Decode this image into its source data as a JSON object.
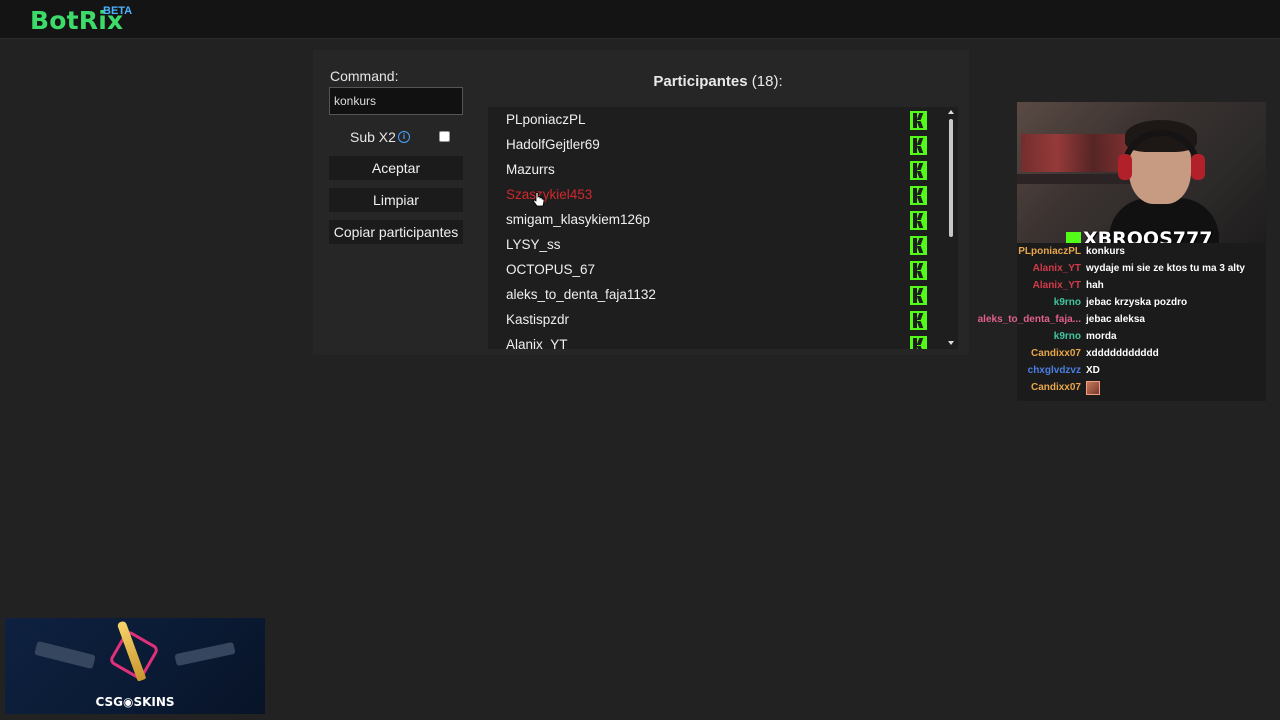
{
  "header": {
    "brand": "BotRix",
    "badge": "BETA"
  },
  "command": {
    "label": "Command:",
    "value": "konkurs"
  },
  "sub_option": {
    "label": "Sub X2",
    "checked": false
  },
  "buttons": {
    "accept": "Aceptar",
    "clear": "Limpiar",
    "copy": "Copiar participantes"
  },
  "participants": {
    "title": "Participantes",
    "count": "(18)",
    "suffix": ":",
    "items": [
      {
        "name": "PLponiaczPL",
        "highlight": false
      },
      {
        "name": "HadolfGejtler69",
        "highlight": false
      },
      {
        "name": "Mazurrs",
        "highlight": false
      },
      {
        "name": "Szaszykiel453",
        "highlight": true
      },
      {
        "name": "smigam_klasykiem126p",
        "highlight": false
      },
      {
        "name": "LYSY_ss",
        "highlight": false
      },
      {
        "name": "OCTOPUS_67",
        "highlight": false
      },
      {
        "name": "aleks_to_denta_faja1132",
        "highlight": false
      },
      {
        "name": "Kastispzdr",
        "highlight": false
      },
      {
        "name": "Alanix_YT",
        "highlight": false
      }
    ],
    "platform_icon": "kick-icon",
    "platform_color": "#53fc18"
  },
  "stream": {
    "streamer_name": "XBROOS777",
    "chat": [
      {
        "user": "PLponiaczPL",
        "color": "#e8a64a",
        "message": "konkurs"
      },
      {
        "user": "Alanix_YT",
        "color": "#d43a4a",
        "message": "wydaje mi sie ze ktos tu ma 3 alty"
      },
      {
        "user": "Alanix_YT",
        "color": "#d43a4a",
        "message": "hah"
      },
      {
        "user": "k9rno",
        "color": "#3fc7a0",
        "message": "jebac krzyska pozdro"
      },
      {
        "user": "aleks_to_denta_faja...",
        "color": "#e0608a",
        "message": "jebac aleksa"
      },
      {
        "user": "k9rno",
        "color": "#3fc7a0",
        "message": "morda"
      },
      {
        "user": "Candixx07",
        "color": "#e8a64a",
        "message": "xddddddddddd"
      },
      {
        "user": "chxglvdzvz",
        "color": "#4a7ee0",
        "message": "XD"
      },
      {
        "user": "Candixx07",
        "color": "#e8a64a",
        "message": ""
      }
    ]
  },
  "ad": {
    "text": "CSG◉SKINS"
  }
}
